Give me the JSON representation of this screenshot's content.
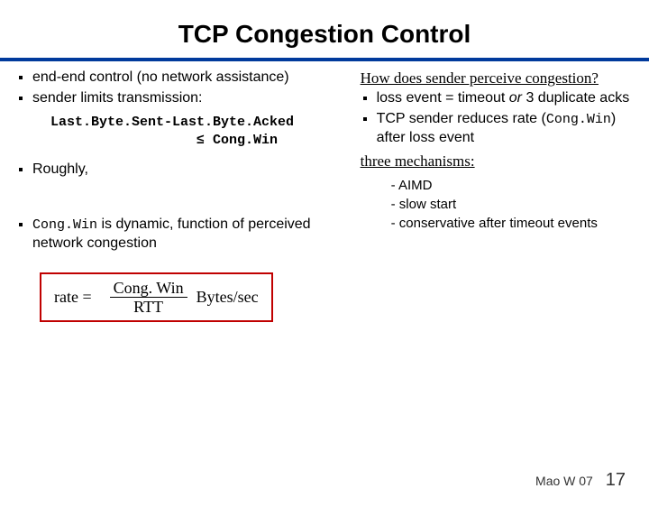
{
  "title": "TCP Congestion Control",
  "left": {
    "b1": "end-end control (no network assistance)",
    "b2": "sender limits transmission:",
    "code1": "Last.Byte.Sent-Last.Byte.Acked",
    "code2": "                  ≤ Cong.Win",
    "b3": "Roughly,",
    "b4_pre": "Cong.Win",
    "b4_post": " is dynamic, function of perceived network congestion"
  },
  "rate": {
    "lhs": "rate =",
    "num": "Cong. Win",
    "den": "RTT",
    "unit": "Bytes/sec"
  },
  "right": {
    "q": "How does  sender perceive congestion?",
    "p1_pre": "loss event = timeout ",
    "p1_or": "or",
    "p1_post": " 3 duplicate acks",
    "p2_pre": "TCP sender reduces rate (",
    "p2_code": "Cong.Win",
    "p2_post": ") after loss event",
    "mech": "three mechanisms:",
    "m1": "AIMD",
    "m2": "slow start",
    "m3": "conservative after timeout events"
  },
  "footer": {
    "course": "Mao W 07",
    "page": "17"
  }
}
